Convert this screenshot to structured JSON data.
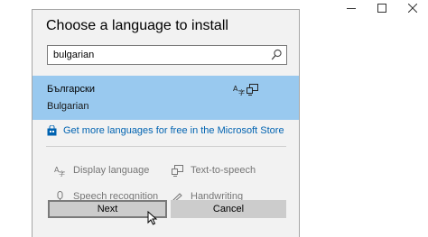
{
  "window_controls": {
    "minimize_icon": "minimize-icon",
    "maximize_icon": "maximize-icon",
    "close_icon": "close-icon"
  },
  "dialog": {
    "title": "Choose a language to install"
  },
  "search": {
    "value": "bulgarian",
    "icon": "search-icon"
  },
  "results": [
    {
      "native_name": "Български",
      "english_name": "Bulgarian",
      "selected": true,
      "feature_icons": [
        "display-language-icon",
        "text-to-speech-icon"
      ]
    }
  ],
  "store_link": {
    "label": "Get more languages for free in the Microsoft Store",
    "icon": "store-bag-icon"
  },
  "features": {
    "display_language": "Display language",
    "text_to_speech": "Text-to-speech",
    "speech_recognition": "Speech recognition",
    "handwriting": "Handwriting"
  },
  "buttons": {
    "next": "Next",
    "cancel": "Cancel"
  },
  "colors": {
    "selection": "#99c9ef",
    "link": "#0063b1",
    "button": "#cccccc",
    "feature_text": "#767676"
  }
}
